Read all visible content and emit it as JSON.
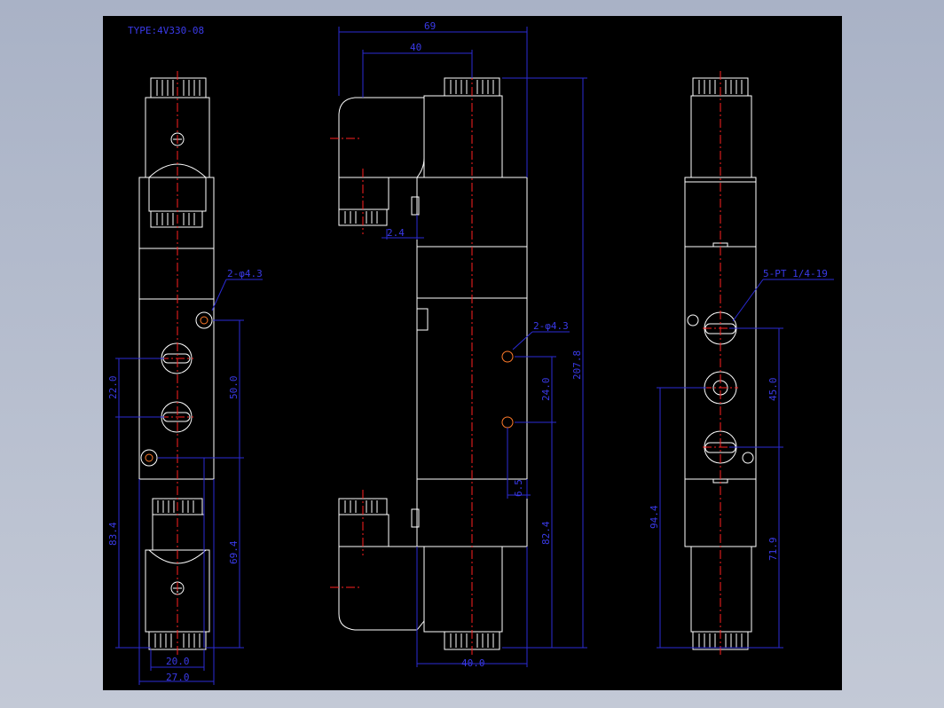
{
  "title": "TYPE:4V330-08",
  "colors": {
    "background": "#000000",
    "outline": "#ffffff",
    "dimension": "#2b2bd6",
    "centerline": "#ff2020",
    "hole": "#ff7a2a"
  },
  "left_view": {
    "hole_note": "2-φ4.3",
    "dims": {
      "port_spacing": "22.0",
      "hole_spacing": "50.0",
      "left_height": "83.4",
      "right_height": "69.4",
      "inner_width": "20.0",
      "outer_width": "27.0"
    }
  },
  "middle_view": {
    "hole_note": "2-φ4.3",
    "dims": {
      "top_width": "69",
      "top_inner": "40",
      "offset": "2.4",
      "hole_spacing": "24.0",
      "small": "6.5",
      "total_height": "207.8",
      "lower_height": "82.4",
      "bottom_width": "40.0"
    }
  },
  "right_view": {
    "port_note": "5-PT 1/4-19",
    "dims": {
      "port_spacing": "45.0",
      "height_left": "94.4",
      "height_right": "71.9"
    }
  }
}
